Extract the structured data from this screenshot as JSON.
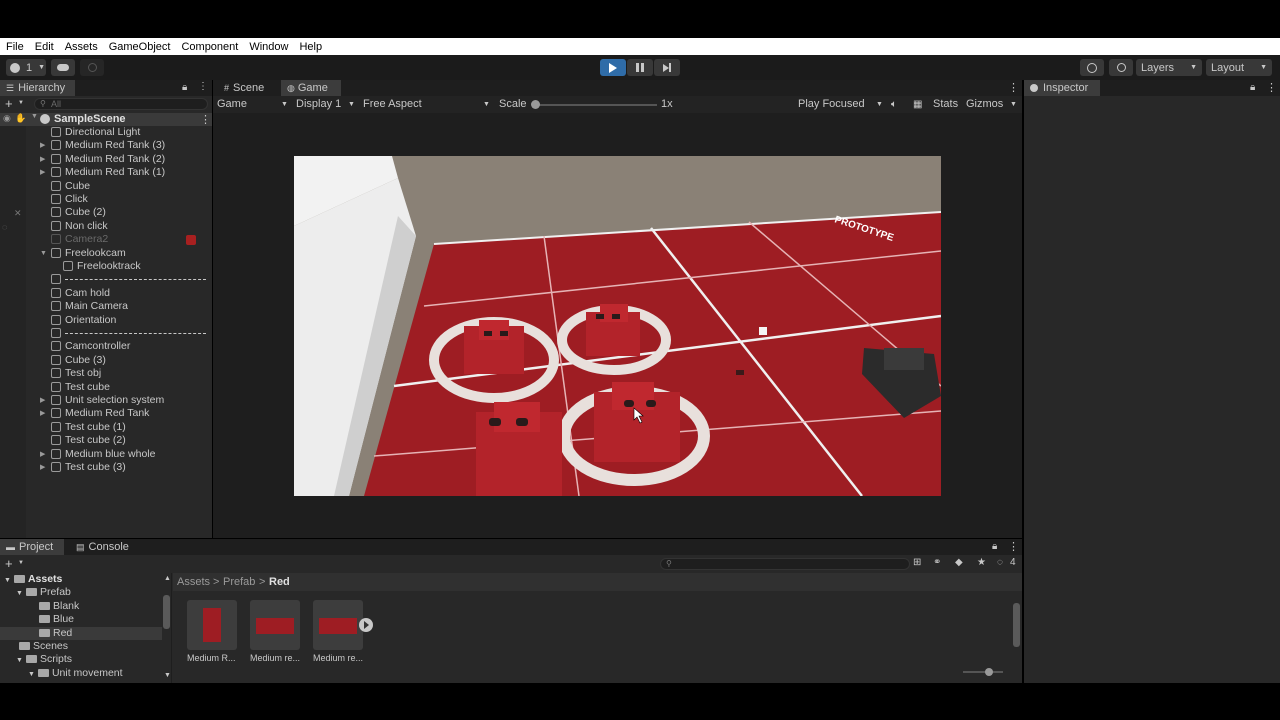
{
  "menu": [
    "File",
    "Edit",
    "Assets",
    "GameObject",
    "Component",
    "Window",
    "Help"
  ],
  "toolbar": {
    "account_count": "1",
    "layers_label": "Layers",
    "layout_label": "Layout"
  },
  "hierarchy": {
    "tab": "Hierarchy",
    "search_placeholder": "All",
    "scene": "SampleScene",
    "rows": [
      {
        "label": "Directional Light",
        "indent": 1,
        "arrow": false
      },
      {
        "label": "Medium Red Tank (3)",
        "indent": 1,
        "arrow": true
      },
      {
        "label": "Medium Red Tank (2)",
        "indent": 1,
        "arrow": true
      },
      {
        "label": "Medium Red Tank (1)",
        "indent": 1,
        "arrow": true
      },
      {
        "label": "Cube",
        "indent": 1,
        "arrow": false
      },
      {
        "label": "Click",
        "indent": 1,
        "arrow": false
      },
      {
        "label": "Cube (2)",
        "indent": 1,
        "arrow": false
      },
      {
        "label": "Non click",
        "indent": 1,
        "arrow": false
      },
      {
        "label": "Camera2",
        "indent": 1,
        "arrow": false,
        "dim": true
      },
      {
        "label": "Freelookcam",
        "indent": 1,
        "arrow": true,
        "open": true
      },
      {
        "label": "Freelooktrack",
        "indent": 2,
        "arrow": false
      },
      {
        "label": "",
        "indent": 1,
        "arrow": false,
        "separator": true
      },
      {
        "label": "Cam hold",
        "indent": 1,
        "arrow": false
      },
      {
        "label": "Main Camera",
        "indent": 1,
        "arrow": false
      },
      {
        "label": "Orientation",
        "indent": 1,
        "arrow": false
      },
      {
        "label": "",
        "indent": 1,
        "arrow": false,
        "separator": true
      },
      {
        "label": "Camcontroller",
        "indent": 1,
        "arrow": false
      },
      {
        "label": "Cube (3)",
        "indent": 1,
        "arrow": false
      },
      {
        "label": "Test obj",
        "indent": 1,
        "arrow": false
      },
      {
        "label": "Test cube",
        "indent": 1,
        "arrow": false
      },
      {
        "label": "Unit selection system",
        "indent": 1,
        "arrow": true
      },
      {
        "label": "Medium Red Tank",
        "indent": 1,
        "arrow": true
      },
      {
        "label": "Test cube (1)",
        "indent": 1,
        "arrow": false
      },
      {
        "label": "Test cube (2)",
        "indent": 1,
        "arrow": false
      },
      {
        "label": "Medium blue whole",
        "indent": 1,
        "arrow": true
      },
      {
        "label": "Test cube (3)",
        "indent": 1,
        "arrow": true
      }
    ]
  },
  "center_tabs": {
    "scene": "Scene",
    "game": "Game"
  },
  "game_bar": {
    "mode": "Game",
    "display": "Display 1",
    "aspect": "Free Aspect",
    "scale_label": "Scale",
    "scale_value": "1x",
    "play_mode": "Play Focused",
    "stats": "Stats",
    "gizmos": "Gizmos"
  },
  "inspector": {
    "tab": "Inspector"
  },
  "bottom_tabs": {
    "project": "Project",
    "console": "Console"
  },
  "project": {
    "tree": [
      {
        "label": "Assets",
        "indent": 0,
        "bold": true
      },
      {
        "label": "Prefab",
        "indent": 1
      },
      {
        "label": "Blank",
        "indent": 2
      },
      {
        "label": "Blue",
        "indent": 2
      },
      {
        "label": "Red",
        "indent": 2,
        "selected": true
      },
      {
        "label": "Scenes",
        "indent": 1
      },
      {
        "label": "Scripts",
        "indent": 1
      },
      {
        "label": "Unit movement",
        "indent": 2
      }
    ],
    "breadcrumb": [
      "Assets",
      "Prefab",
      "Red"
    ],
    "assets": [
      "Medium R...",
      "Medium re...",
      "Medium re..."
    ],
    "hidden_count": "4"
  },
  "colors": {
    "floor": "#9e1d23",
    "wall": "#8a8176",
    "accent": "#2f6ca8"
  },
  "game_view": {
    "floor_stamp": "PROTOTYPE"
  }
}
